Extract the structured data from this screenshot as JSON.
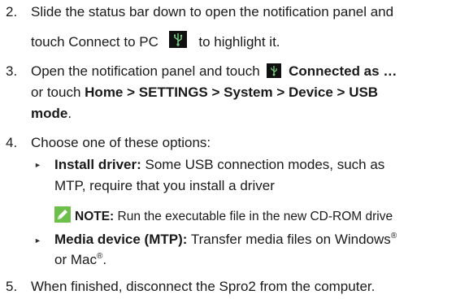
{
  "steps": [
    {
      "number": "2.",
      "line1": "Slide the status bar down to open the notification panel and",
      "line2_before": "touch Connect to PC",
      "icon": "usb-icon",
      "line2_after": "to highlight it."
    },
    {
      "number": "3.",
      "line1_before": "Open the notification panel and touch",
      "icon": "usb-icon",
      "line1_bold": "Connected as …",
      "line2_before": "or touch ",
      "line2_bold": "Home > SETTINGS > System > Device > USB",
      "line3_bold": "mode",
      "line3_after": "."
    },
    {
      "number": "4.",
      "line1": "Choose one of these options:",
      "options": [
        {
          "bullet": "►",
          "bold": "Install driver:",
          "text1": " Some USB connection modes, such as",
          "text2": "MTP, require that you install a driver"
        },
        {
          "bullet": "►",
          "bold": "Media device (MTP):",
          "text1": " Transfer media files on Windows",
          "sup1": "®",
          "text2": "or Mac",
          "sup2": "®",
          "text2_after": "."
        }
      ],
      "note": {
        "icon": "pencil-icon",
        "label": "NOTE:",
        "text": " Run the executable file in the new CD-ROM drive"
      }
    },
    {
      "number": "5.",
      "line1": "When finished, disconnect the Spro2 from the computer."
    }
  ]
}
